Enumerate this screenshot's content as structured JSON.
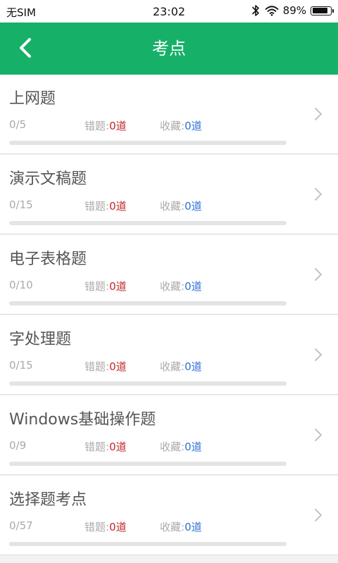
{
  "status_bar": {
    "carrier": "无SIM",
    "time": "23:02",
    "battery_percent": "89%",
    "battery_level": 0.89,
    "icons": [
      "bluetooth-icon",
      "wifi-icon",
      "battery-icon"
    ]
  },
  "header": {
    "title": "考点",
    "back_icon": "chevron-left-icon"
  },
  "colors": {
    "accent": "#16b068",
    "wrong_value": "#c0262b",
    "fav_value": "#2f6fd6",
    "muted_text": "#aaaaaa",
    "progress_track": "#e4e4e4"
  },
  "topics": [
    {
      "title": "上网题",
      "progress": "0/5",
      "wrong_label": "错题:",
      "wrong_value": "0道",
      "fav_label": "收藏:",
      "fav_value": "0道",
      "done_fraction": 0
    },
    {
      "title": "演示文稿题",
      "progress": "0/15",
      "wrong_label": "错题:",
      "wrong_value": "0道",
      "fav_label": "收藏:",
      "fav_value": "0道",
      "done_fraction": 0
    },
    {
      "title": "电子表格题",
      "progress": "0/10",
      "wrong_label": "错题:",
      "wrong_value": "0道",
      "fav_label": "收藏:",
      "fav_value": "0道",
      "done_fraction": 0
    },
    {
      "title": "字处理题",
      "progress": "0/15",
      "wrong_label": "错题:",
      "wrong_value": "0道",
      "fav_label": "收藏:",
      "fav_value": "0道",
      "done_fraction": 0
    },
    {
      "title": "Windows基础操作题",
      "progress": "0/9",
      "wrong_label": "错题:",
      "wrong_value": "0道",
      "fav_label": "收藏:",
      "fav_value": "0道",
      "done_fraction": 0
    },
    {
      "title": "选择题考点",
      "progress": "0/57",
      "wrong_label": "错题:",
      "wrong_value": "0道",
      "fav_label": "收藏:",
      "fav_value": "0道",
      "done_fraction": 0
    }
  ]
}
